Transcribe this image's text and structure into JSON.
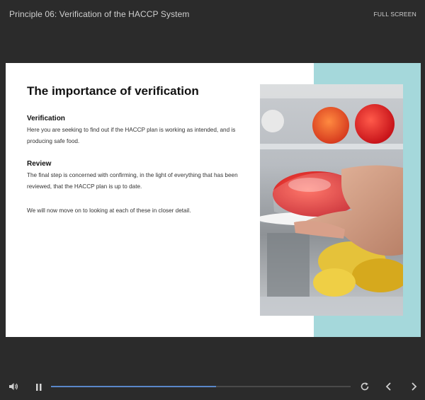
{
  "header": {
    "course_title": "Principle 06: Verification of the HACCP System",
    "fullscreen_label": "FULL SCREEN"
  },
  "slide": {
    "heading": "The importance of verification",
    "sections": [
      {
        "title": "Verification",
        "body": "Here you are seeking to find out if the HACCP plan is working as intended, and is producing safe food."
      },
      {
        "title": "Review",
        "body": "The final step is concerned with confirming, in the light of everything that has been reviewed, that the HACCP plan is up to date."
      },
      {
        "title": "",
        "body": "We will now move on to looking at each of these in closer detail."
      }
    ],
    "accent_color": "#a5d8db"
  },
  "player": {
    "progress": 0.55,
    "progress_color": "#5a87c9",
    "icons": [
      "volume-icon",
      "pause-icon",
      "replay-icon",
      "chevron-left-icon",
      "chevron-right-icon"
    ]
  }
}
